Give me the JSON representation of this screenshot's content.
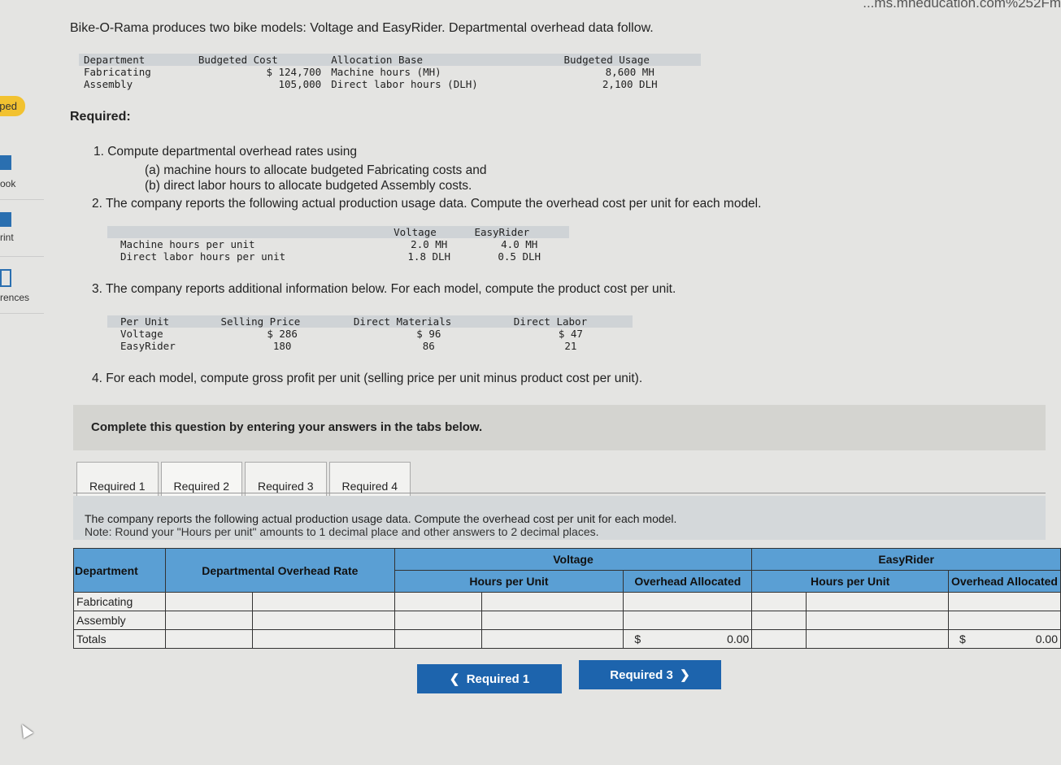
{
  "url_fragment": "...ms.mheducation.com%252Fm",
  "sidebar": {
    "badge": "pped",
    "items": [
      {
        "label": "ook",
        "icon": "book-icon"
      },
      {
        "label": "rint",
        "icon": "print-icon"
      },
      {
        "label": "rences",
        "icon": "references-icon"
      }
    ]
  },
  "intro": "Bike-O-Rama produces two bike models: Voltage and EasyRider. Departmental overhead data follow.",
  "overhead_table": {
    "headers": [
      "Department",
      "Budgeted Cost",
      "Allocation Base",
      "Budgeted Usage"
    ],
    "rows": [
      [
        "Fabricating",
        "$ 124,700",
        "Machine hours (MH)",
        "8,600 MH"
      ],
      [
        "Assembly",
        "105,000",
        "Direct labor hours (DLH)",
        "2,100 DLH"
      ]
    ]
  },
  "required_label": "Required:",
  "q1": "1. Compute departmental overhead rates using",
  "q1a": "(a) machine hours to allocate budgeted Fabricating costs and",
  "q1b": "(b) direct labor hours to allocate budgeted Assembly costs.",
  "q2": "2. The company reports the following actual production usage data. Compute the overhead cost per unit for each model.",
  "usage_table": {
    "headers": [
      "",
      "Voltage",
      "EasyRider"
    ],
    "rows": [
      [
        "Machine hours per unit",
        "2.0 MH",
        "4.0 MH"
      ],
      [
        "Direct labor hours per unit",
        "1.8 DLH",
        "0.5 DLH"
      ]
    ]
  },
  "q3": "3. The company reports additional information below. For each model, compute the product cost per unit.",
  "unit_table": {
    "headers": [
      "Per Unit",
      "Selling Price",
      "Direct Materials",
      "Direct Labor"
    ],
    "rows": [
      [
        "Voltage",
        "$ 286",
        "$ 96",
        "$ 47"
      ],
      [
        "EasyRider",
        "180",
        "86",
        "21"
      ]
    ]
  },
  "q4": "4. For each model, compute gross profit per unit (selling price per unit minus product cost per unit).",
  "banner": "Complete this question by entering your answers in the tabs below.",
  "tabs": [
    "Required 1",
    "Required 2",
    "Required 3",
    "Required 4"
  ],
  "active_tab": "Required 2",
  "instruction": "The company reports the following actual production usage data. Compute the overhead cost per unit for each model.",
  "note": "Note: Round your \"Hours per unit\" amounts to 1 decimal place and other answers to 2 decimal places.",
  "answer_table": {
    "department": "Department",
    "rate": "Departmental Overhead Rate",
    "voltage": "Voltage",
    "easyrider": "EasyRider",
    "hours": "Hours per Unit",
    "allocated": "Overhead Allocated",
    "rows": [
      "Fabricating",
      "Assembly",
      "Totals"
    ],
    "dollar": "$",
    "voltage_total": "0.00",
    "easyrider_total": "0.00"
  },
  "nav": {
    "prev": "Required 1",
    "next": "Required 3"
  }
}
